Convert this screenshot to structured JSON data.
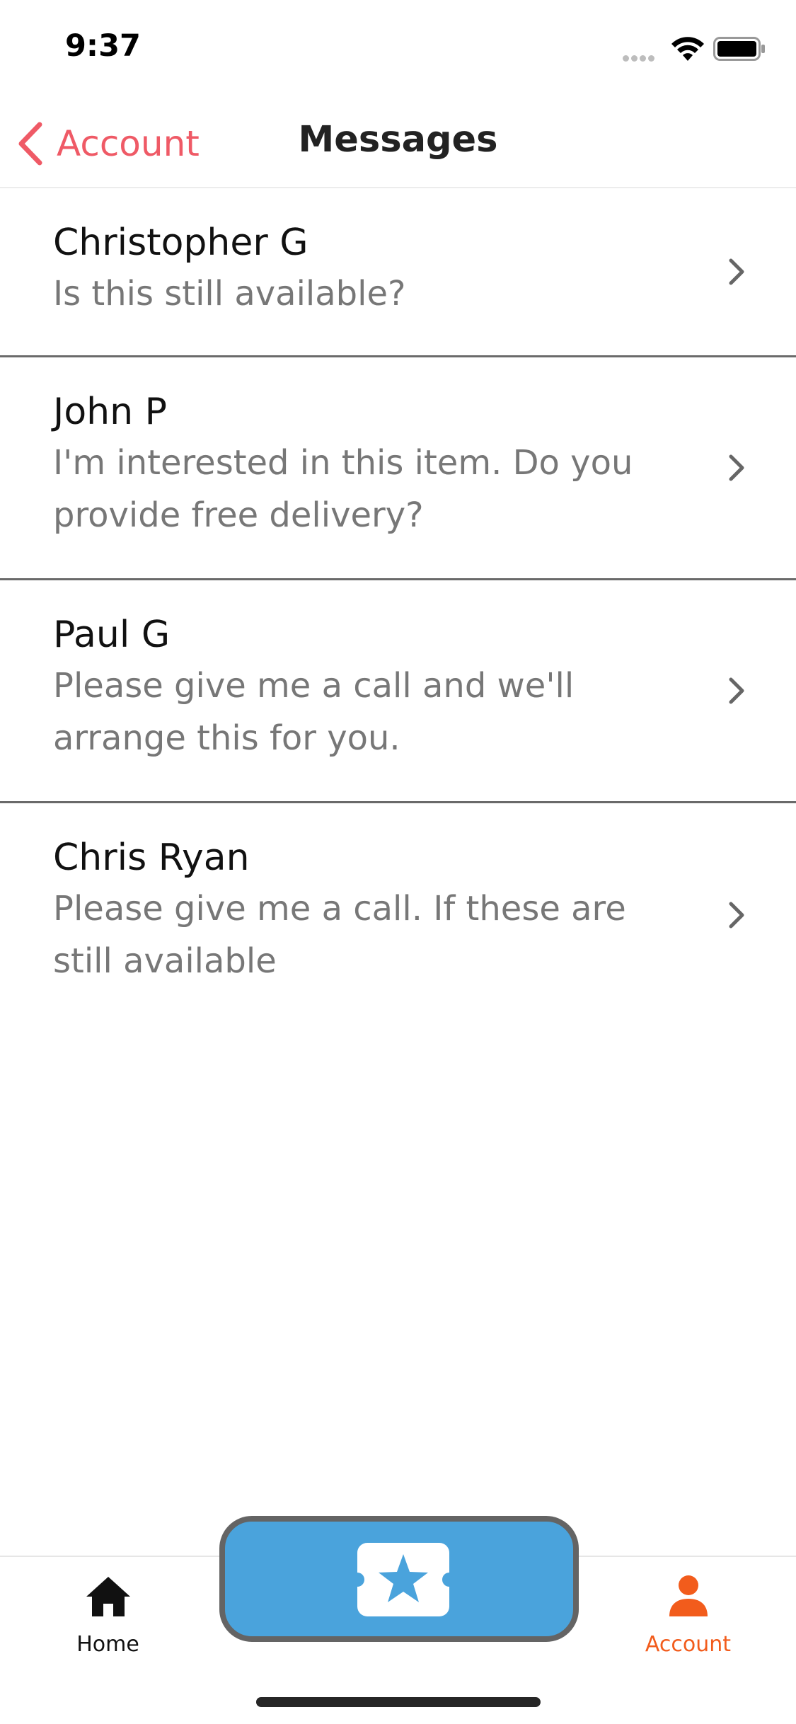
{
  "status_bar": {
    "time": "9:37"
  },
  "nav": {
    "back_label": "Account",
    "title": "Messages"
  },
  "messages": [
    {
      "sender": "Christopher G",
      "preview": "Is this still available?"
    },
    {
      "sender": "John P",
      "preview": "I'm interested in this item. Do you provide free delivery?"
    },
    {
      "sender": "Paul G",
      "preview": "Please give me a call and we'll arrange this for you."
    },
    {
      "sender": "Chris Ryan",
      "preview": "Please give me a call. If these are still available"
    }
  ],
  "tab_bar": {
    "home_label": "Home",
    "account_label": "Account",
    "center_icon": "ticket-star-icon",
    "active_tab": "Account"
  },
  "colors": {
    "accent_back": "#ef5a66",
    "active_tab": "#f25c1c",
    "center_button": "#4aa3dc"
  }
}
